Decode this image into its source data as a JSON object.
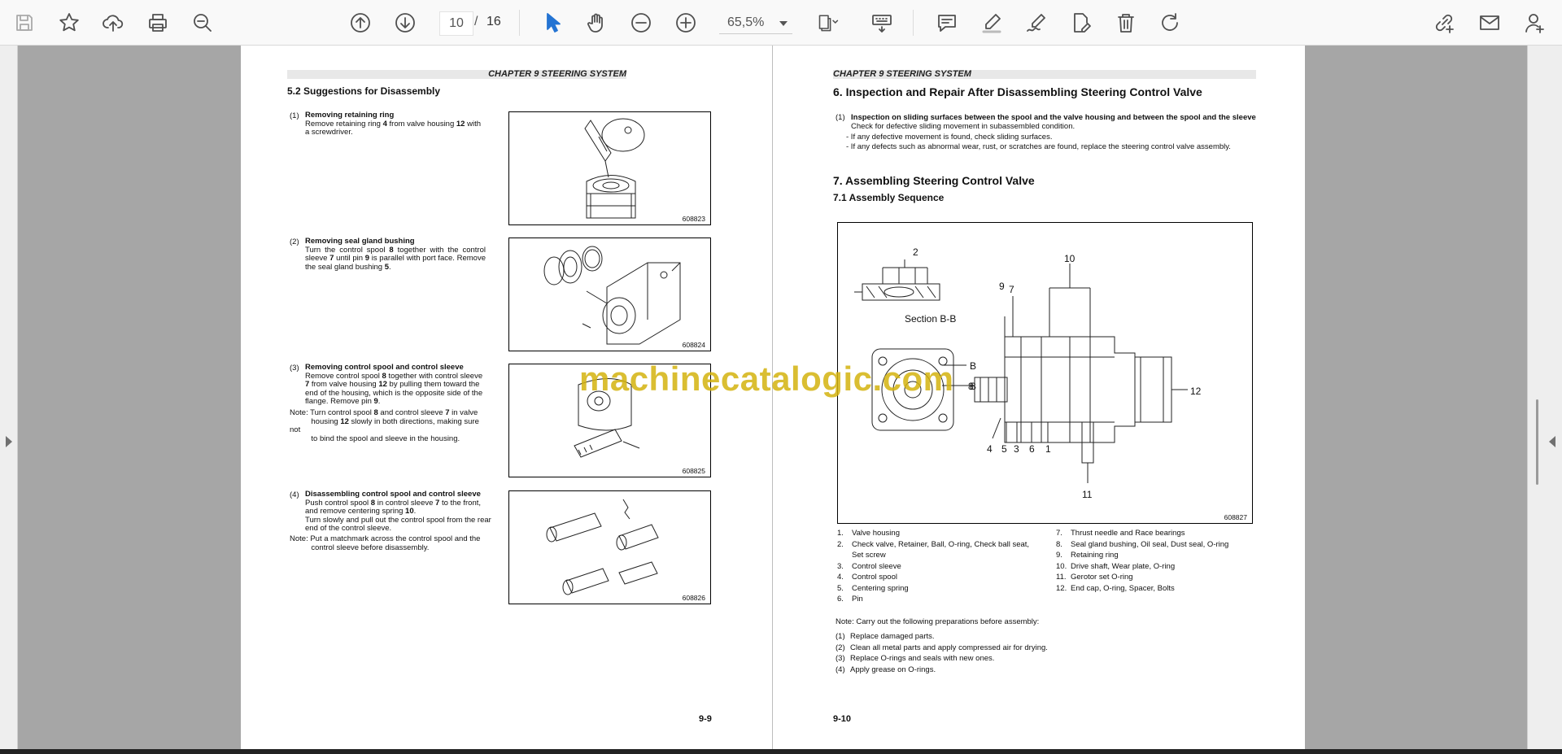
{
  "toolbar": {
    "page_current": "10",
    "page_separator": "/",
    "page_total": "16",
    "zoom": "65,5%",
    "icons": [
      "save-icon",
      "star-icon",
      "cloud-upload-icon",
      "print-icon",
      "zoom-search-icon",
      "page-up-icon",
      "page-down-icon",
      "zoom-out-icon",
      "zoom-in-icon",
      "select-cursor-icon",
      "hand-icon",
      "fit-page-icon",
      "keyboard-icon",
      "comment-icon",
      "highlight-icon",
      "sign-icon",
      "edit-pdf-icon",
      "delete-icon",
      "redo-icon",
      "share-link-icon",
      "email-icon",
      "add-user-icon"
    ],
    "accent_color": "#2474d3"
  },
  "watermark": "machinecatalogic.com",
  "page_left": {
    "chapter_header": "CHAPTER 9 STEERING SYSTEM",
    "section_title": "5.2     Suggestions for Disassembly",
    "steps": [
      {
        "num": "(1)",
        "title": "Removing retaining ring",
        "figure": "608823"
      },
      {
        "num": "(2)",
        "title": "Removing seal gland bushing",
        "figure": "608824"
      },
      {
        "num": "(3)",
        "title": "Removing control spool and control sleeve",
        "figure": "608825"
      },
      {
        "num": "(4)",
        "title": "Disassembling control spool and control sleeve",
        "figure": "608826"
      }
    ],
    "folio": "9-9"
  },
  "page_right": {
    "chapter_header": "CHAPTER 9 STEERING SYSTEM",
    "heading6": "6.     Inspection and Repair After Disassembling Steering Control Valve",
    "inspect_num": "(1)",
    "inspect_title": "Inspection on sliding surfaces between the spool and the valve housing and between the spool and the sleeve",
    "inspect_text": "Check for defective sliding movement in subassembled condition.",
    "inspect_bullet1": "-   If any defective movement is found, check sliding surfaces.",
    "inspect_bullet2": "-   If any defects such as abnormal wear, rust, or scratches are found, replace the steering control valve assembly.",
    "heading7": "7.     Assembling Steering Control Valve",
    "heading71": "7.1     Assembly Sequence",
    "figure_number": "608827",
    "figure_labels": {
      "section": "Section B-B",
      "b": "B"
    },
    "parts_left": [
      {
        "n": "1.",
        "t": "Valve housing"
      },
      {
        "n": "2.",
        "t": "Check valve, Retainer, Ball, O-ring, Check ball seat,"
      },
      {
        "n": "",
        "t": "Set screw"
      },
      {
        "n": "3.",
        "t": "Control sleeve"
      },
      {
        "n": "4.",
        "t": "Control spool"
      },
      {
        "n": "5.",
        "t": "Centering spring"
      },
      {
        "n": "6.",
        "t": "Pin"
      }
    ],
    "parts_right": [
      {
        "n": "7.",
        "t": "Thrust needle and Race bearings"
      },
      {
        "n": "8.",
        "t": "Seal gland bushing, Oil seal, Dust seal, O-ring"
      },
      {
        "n": "9.",
        "t": "Retaining ring"
      },
      {
        "n": "10.",
        "t": "Drive shaft, Wear plate, O-ring"
      },
      {
        "n": "11.",
        "t": "Gerotor set O-ring"
      },
      {
        "n": "12.",
        "t": "End cap, O-ring, Spacer, Bolts"
      }
    ],
    "note": "Note: Carry out the following preparations before assembly:",
    "preps": [
      {
        "n": "(1)",
        "t": "Replace damaged parts."
      },
      {
        "n": "(2)",
        "t": "Clean all metal parts and apply compressed air for drying."
      },
      {
        "n": "(3)",
        "t": "Replace O-rings and seals with new ones."
      },
      {
        "n": "(4)",
        "t": "Apply grease on O-rings."
      }
    ],
    "folio": "9-10"
  }
}
